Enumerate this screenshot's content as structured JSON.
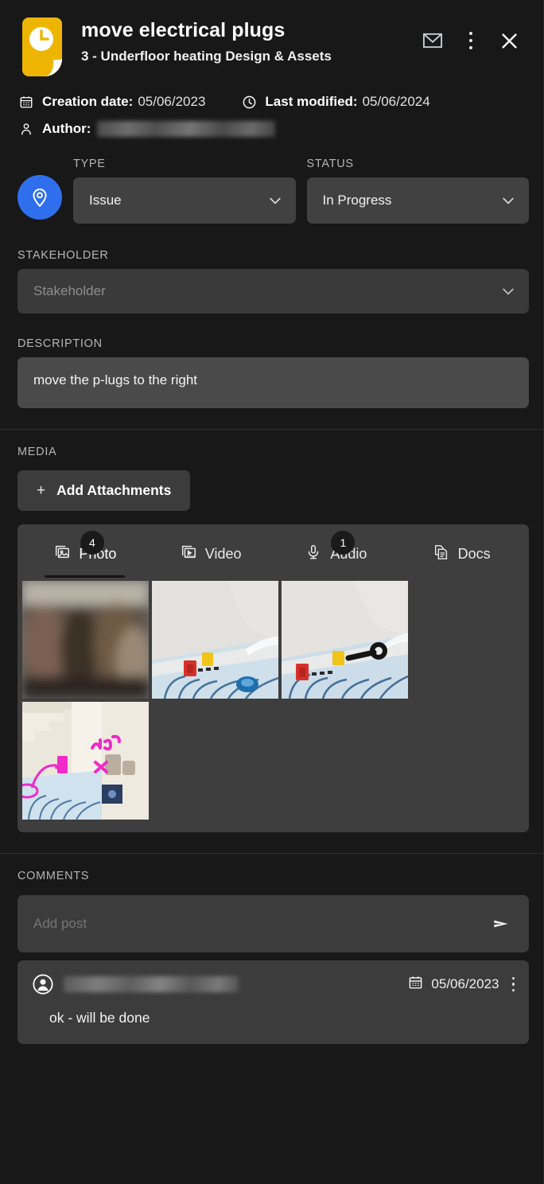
{
  "header": {
    "icon": "document-clock-icon",
    "title": "move electrical plugs",
    "subtitle": "3 - Underfloor heating Design & Assets",
    "actions": {
      "mail_label": "mail-icon",
      "menu_label": "more-options-icon",
      "close_label": "close-icon"
    }
  },
  "meta": {
    "creation_label": "Creation date",
    "creation_colon": ":",
    "creation_value": "05/06/2023",
    "modified_label": "Last modified",
    "modified_colon": ":",
    "modified_value": "05/06/2024",
    "author_label": "Author",
    "author_colon": ":",
    "author_value": ""
  },
  "fields": {
    "type_label": "TYPE",
    "type_value": "Issue",
    "status_label": "STATUS",
    "status_value": "In Progress",
    "stakeholder_label": "STAKEHOLDER",
    "stakeholder_placeholder": "Stakeholder",
    "description_label": "DESCRIPTION",
    "description_value": "move the p-lugs to the right"
  },
  "media": {
    "section_label": "MEDIA",
    "add_attachments_plus": "+",
    "add_attachments_label": "Add Attachments",
    "tabs": [
      {
        "label": "Photo",
        "icon": "photo-icon",
        "badge": "4",
        "active": true
      },
      {
        "label": "Video",
        "icon": "video-icon",
        "badge": "",
        "active": false
      },
      {
        "label": "Audio",
        "icon": "audio-microphone-icon",
        "badge": "1",
        "active": false
      },
      {
        "label": "Docs",
        "icon": "docs-icon",
        "badge": "",
        "active": false
      }
    ],
    "thumbnail_count": 4
  },
  "comments": {
    "section_label": "COMMENTS",
    "add_post_placeholder": "Add post",
    "send_icon": "send-icon",
    "items": [
      {
        "author": "",
        "date": "05/06/2023",
        "text": "ok - will be done"
      }
    ]
  },
  "colors": {
    "background": "#181818",
    "field": "#414141",
    "panel": "#3e3e3e",
    "accent_blue": "#2f6fed",
    "accent_yellow": "#edb500"
  }
}
